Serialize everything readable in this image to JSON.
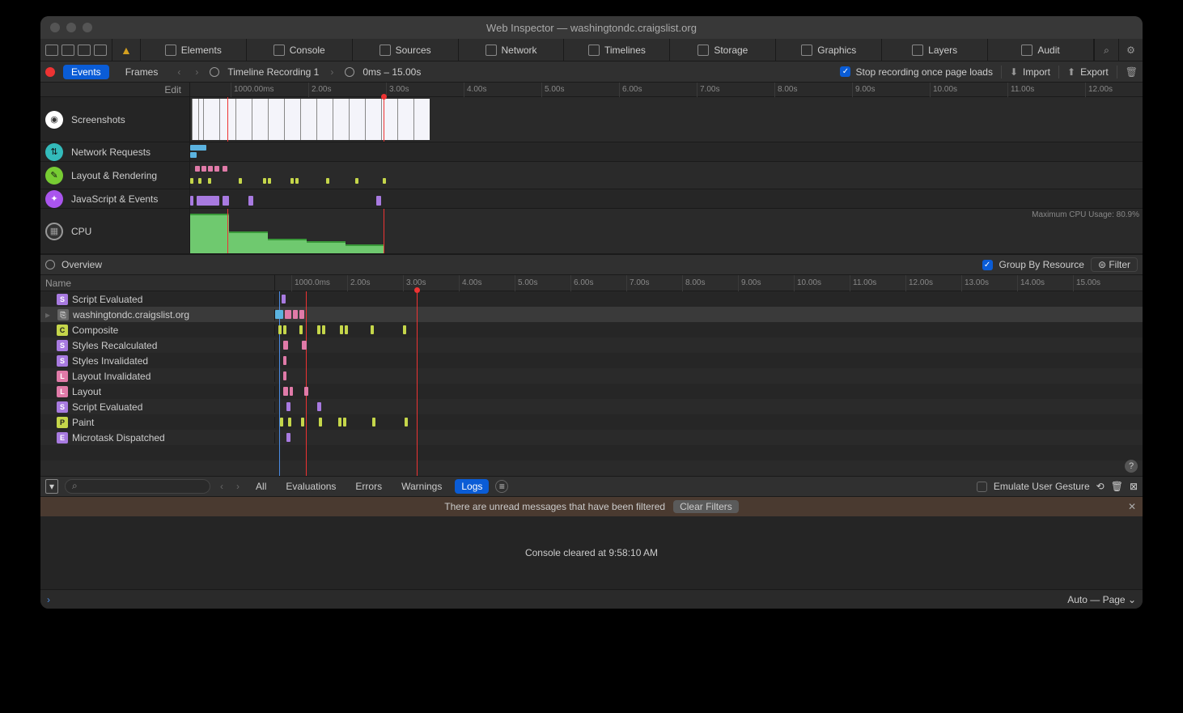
{
  "window": {
    "title": "Web Inspector — washingtondc.craigslist.org"
  },
  "tabs": [
    "Elements",
    "Console",
    "Sources",
    "Network",
    "Timelines",
    "Storage",
    "Graphics",
    "Layers",
    "Audit"
  ],
  "subbar": {
    "events": "Events",
    "frames": "Frames",
    "recording": "Timeline Recording 1",
    "range": "0ms – 15.00s",
    "stop_label": "Stop recording once page loads",
    "import": "Import",
    "export": "Export"
  },
  "ruler": {
    "edit": "Edit",
    "ticks": [
      "1000.00ms",
      "2.00s",
      "3.00s",
      "4.00s",
      "5.00s",
      "6.00s",
      "7.00s",
      "8.00s",
      "9.00s",
      "10.00s",
      "11.00s",
      "12.00s"
    ]
  },
  "tracks": {
    "screenshots": "Screenshots",
    "network": "Network Requests",
    "layout": "Layout & Rendering",
    "js": "JavaScript & Events",
    "cpu": "CPU",
    "cpu_note": "Maximum CPU Usage: 80.9%"
  },
  "midbar": {
    "overview": "Overview",
    "group": "Group By Resource",
    "filter": "Filter"
  },
  "detail": {
    "name_header": "Name",
    "ticks": [
      "1000.0ms",
      "2.00s",
      "3.00s",
      "4.00s",
      "5.00s",
      "6.00s",
      "7.00s",
      "8.00s",
      "9.00s",
      "10.00s",
      "11.00s",
      "12.00s",
      "13.00s",
      "14.00s",
      "15.00s"
    ],
    "rows": [
      {
        "badge": "S",
        "cls": "b-s",
        "label": "Script Evaluated"
      },
      {
        "badge": "",
        "cls": "b-f",
        "label": "washingtondc.craigslist.org",
        "disc": true,
        "selected": true
      },
      {
        "badge": "C",
        "cls": "b-c",
        "label": "Composite"
      },
      {
        "badge": "S",
        "cls": "b-s",
        "label": "Styles Recalculated"
      },
      {
        "badge": "S",
        "cls": "b-s",
        "label": "Styles Invalidated"
      },
      {
        "badge": "L",
        "cls": "b-l",
        "label": "Layout Invalidated"
      },
      {
        "badge": "L",
        "cls": "b-l",
        "label": "Layout"
      },
      {
        "badge": "S",
        "cls": "b-s",
        "label": "Script Evaluated"
      },
      {
        "badge": "P",
        "cls": "b-p",
        "label": "Paint"
      },
      {
        "badge": "E",
        "cls": "b-e",
        "label": "Microtask Dispatched"
      }
    ]
  },
  "console": {
    "filters": [
      "All",
      "Evaluations",
      "Errors",
      "Warnings",
      "Logs"
    ],
    "emulate": "Emulate User Gesture",
    "notice": "There are unread messages that have been filtered",
    "clear": "Clear Filters",
    "body": "Console cleared at 9:58:10 AM",
    "context": "Auto — Page"
  }
}
